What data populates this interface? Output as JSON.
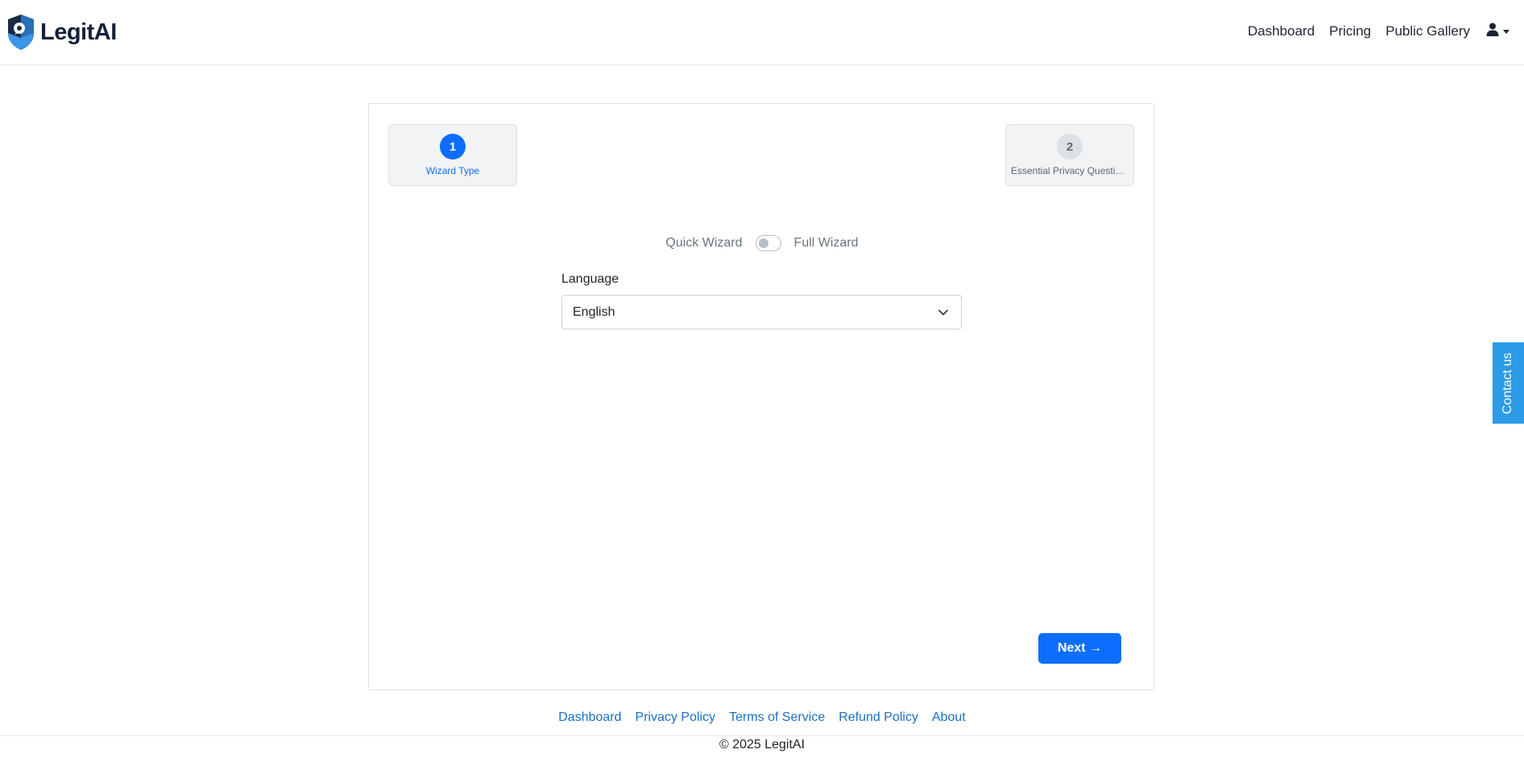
{
  "brand": {
    "name": "LegitAI",
    "logo_icon": "shield-logo-icon"
  },
  "nav": {
    "links": [
      "Dashboard",
      "Pricing",
      "Public Gallery"
    ],
    "user_icon": "user-icon"
  },
  "wizard": {
    "steps": [
      {
        "number": "1",
        "label": "Wizard Type",
        "active": true
      },
      {
        "number": "2",
        "label": "Essential Privacy Questions",
        "active": false
      }
    ],
    "mode": {
      "left_label": "Quick Wizard",
      "right_label": "Full Wizard",
      "full_enabled": false
    },
    "language": {
      "label": "Language",
      "selected": "English"
    },
    "next_label": "Next →"
  },
  "footer": {
    "links": [
      "Dashboard",
      "Privacy Policy",
      "Terms of Service",
      "Refund Policy",
      "About"
    ],
    "copyright": "© 2025 LegitAI"
  },
  "contact_tab": {
    "label": "Contact us"
  },
  "colors": {
    "primary": "#0d6efd",
    "contact_tab": "#2c9be8",
    "link": "#1a6fc2",
    "brand_text": "#152238"
  }
}
